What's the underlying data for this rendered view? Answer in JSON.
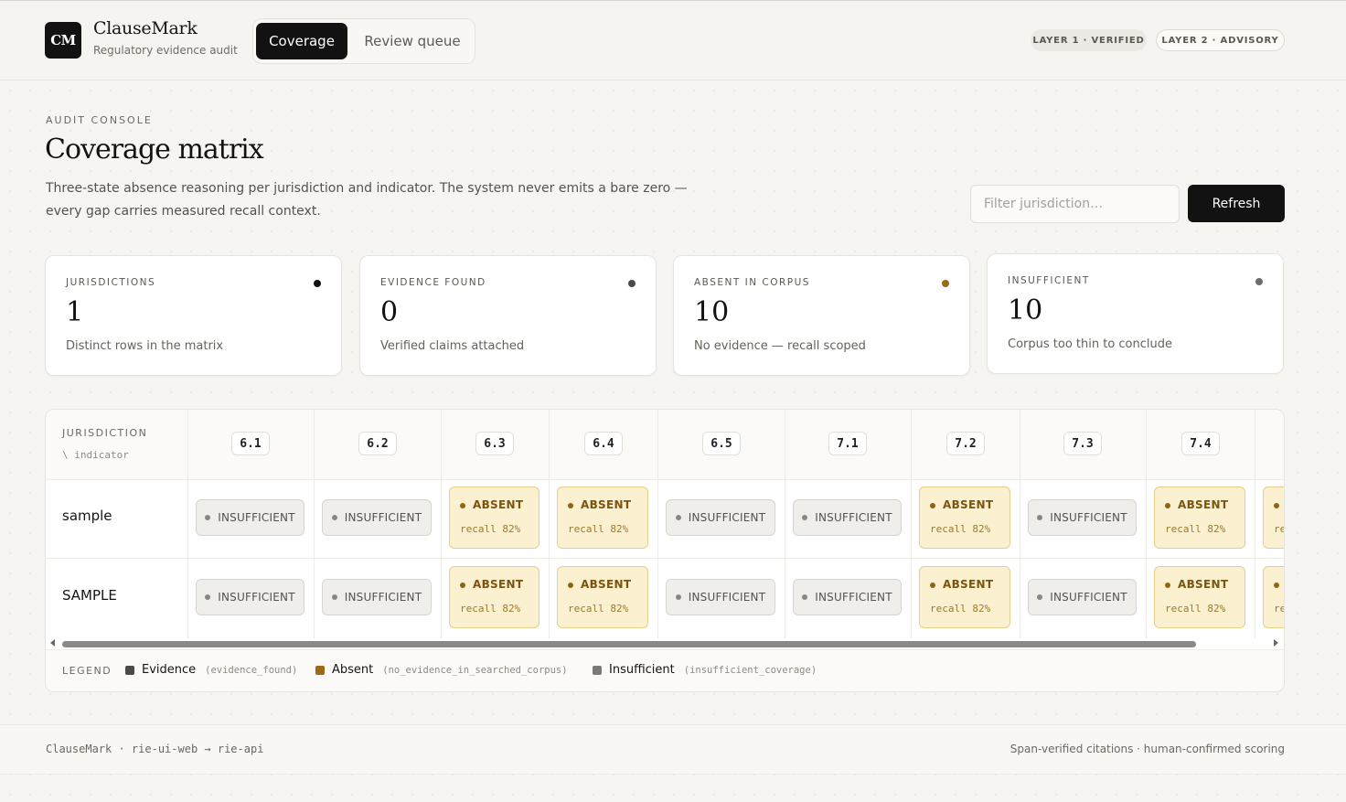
{
  "header": {
    "logo_text": "CM",
    "brand_name": "ClauseMark",
    "brand_sub": "Regulatory evidence audit",
    "tabs": [
      {
        "label": "Coverage",
        "active": true
      },
      {
        "label": "Review queue",
        "active": false
      }
    ],
    "layer1": "LAYER 1 · VERIFIED",
    "layer2": "LAYER 2 · ADVISORY"
  },
  "page": {
    "eyebrow": "AUDIT CONSOLE",
    "title": "Coverage matrix",
    "description": "Three-state absence reasoning per jurisdiction and indicator. The system never emits a bare zero — every gap carries measured recall context.",
    "filter_placeholder": "Filter jurisdiction…",
    "refresh_label": "Refresh"
  },
  "stats": [
    {
      "label": "JURISDICTIONS",
      "value": "1",
      "caption": "Distinct rows in the matrix",
      "dot_color": "#121212"
    },
    {
      "label": "EVIDENCE FOUND",
      "value": "0",
      "caption": "Verified claims attached",
      "dot_color": "#4a4a48"
    },
    {
      "label": "ABSENT IN CORPUS",
      "value": "10",
      "caption": "No evidence — recall scoped",
      "dot_color": "#9a6a16"
    },
    {
      "label": "INSUFFICIENT",
      "value": "10",
      "caption": "Corpus too thin to conclude",
      "dot_color": "#6e6d69"
    }
  ],
  "matrix": {
    "corner_title": "JURISDICTION",
    "corner_sub": "\\ indicator",
    "indicators": [
      "6.1",
      "6.2",
      "6.3",
      "6.4",
      "6.5",
      "7.1",
      "7.2",
      "7.3",
      "7.4"
    ],
    "rows": [
      {
        "label": "sample",
        "cells": [
          "insufficient",
          "insufficient",
          "absent",
          "absent",
          "insufficient",
          "insufficient",
          "absent",
          "insufficient",
          "absent",
          "absent"
        ]
      },
      {
        "label": "SAMPLE",
        "cells": [
          "insufficient",
          "insufficient",
          "absent",
          "absent",
          "insufficient",
          "insufficient",
          "absent",
          "insufficient",
          "absent",
          "absent"
        ]
      }
    ],
    "insufficient_label": "INSUFFICIENT",
    "absent_label": "ABSENT",
    "recall_text": "recall 82%"
  },
  "legend": {
    "title": "LEGEND",
    "items": [
      {
        "label": "Evidence",
        "code": "(evidence_found)",
        "color": "#4a4a48"
      },
      {
        "label": "Absent",
        "code": "(no_evidence_in_searched_corpus)",
        "color": "#9a6a16"
      },
      {
        "label": "Insufficient",
        "code": "(insufficient_coverage)",
        "color": "#7b7a76"
      }
    ]
  },
  "footer": {
    "left": "ClauseMark · rie-ui-web → rie-api",
    "right": "Span-verified citations · human-confirmed scoring"
  }
}
